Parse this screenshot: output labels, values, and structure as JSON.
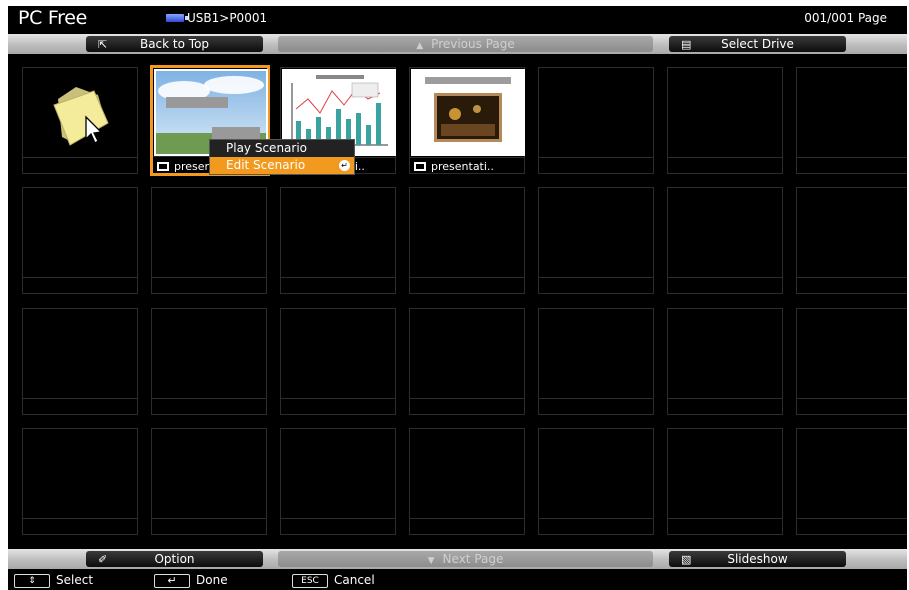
{
  "header": {
    "app_title": "PC Free",
    "path": "USB1>P0001",
    "page_count": "001/001 Page"
  },
  "top_bar": {
    "back_to_top": "Back to Top",
    "previous_page": "Previous Page",
    "select_drive": "Select Drive"
  },
  "files": [
    {
      "name": "",
      "type": "folder"
    },
    {
      "name": "presentati..",
      "type": "photo-scenario"
    },
    {
      "name": "presentati..",
      "type": "chart-scenario"
    },
    {
      "name": "presentati..",
      "type": "night-scenario"
    }
  ],
  "context_menu": {
    "items": [
      {
        "label": "Play Scenario"
      },
      {
        "label": "Edit Scenario"
      }
    ]
  },
  "bottom_bar": {
    "option": "Option",
    "next_page": "Next Page",
    "slideshow": "Slideshow"
  },
  "footer": {
    "select": "Select",
    "done": "Done",
    "esc_key": "ESC",
    "cancel": "Cancel"
  },
  "colors": {
    "selection": "#f29a1f",
    "background": "#000000"
  }
}
